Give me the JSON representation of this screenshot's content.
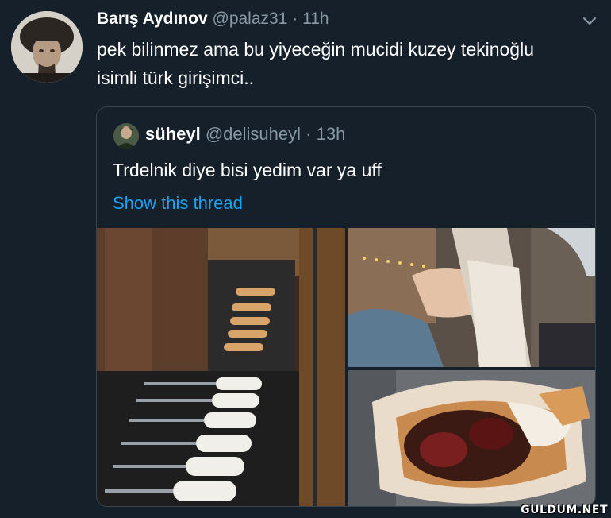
{
  "tweet": {
    "author": {
      "display_name": "Barış Aydınov",
      "handle": "@palaz31",
      "separator": "·",
      "time": "11h"
    },
    "text": "pek bilinmez ama bu yiyeceğin mucidi kuzey tekinoğlu isimli türk girişimci..",
    "menu_icon": "chevron-down-icon"
  },
  "quoted_tweet": {
    "author": {
      "display_name": "süheyl",
      "handle": "@delisuheyl",
      "separator": "·",
      "time": "13h"
    },
    "text": "Trdelnik diye bisi yedim var ya uff",
    "thread_link": "Show this thread",
    "media": [
      {
        "name": "trdelnik-grill-photo"
      },
      {
        "name": "trdelnik-hand-photo"
      },
      {
        "name": "trdelnik-closeup-photo"
      }
    ]
  },
  "watermark": "GULDUM.NET"
}
